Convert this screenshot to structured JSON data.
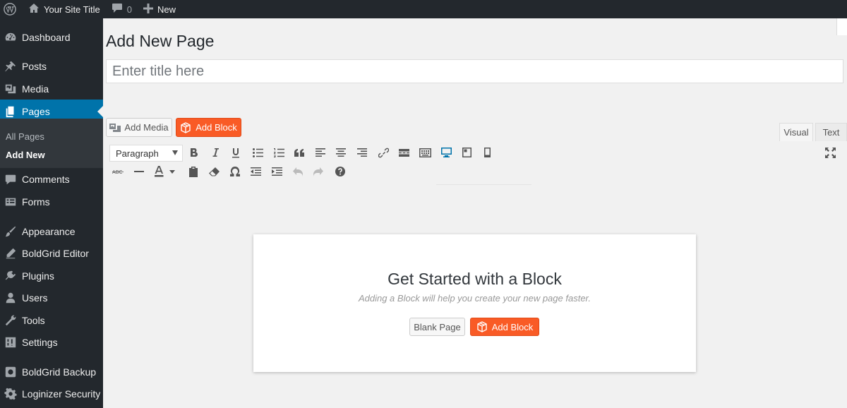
{
  "adminbar": {
    "site_title": "Your Site Title",
    "comments_count": "0",
    "new_label": "New"
  },
  "sidebar": {
    "items": [
      {
        "label": "Dashboard",
        "icon": "dashboard-icon"
      },
      {
        "label": "Posts",
        "icon": "pin-icon"
      },
      {
        "label": "Media",
        "icon": "media-icon"
      },
      {
        "label": "Pages",
        "icon": "page-icon",
        "active": true
      },
      {
        "label": "Comments",
        "icon": "comment-icon"
      },
      {
        "label": "Forms",
        "icon": "forms-icon"
      },
      {
        "label": "Appearance",
        "icon": "brush-icon"
      },
      {
        "label": "BoldGrid Editor",
        "icon": "pencil-icon"
      },
      {
        "label": "Plugins",
        "icon": "plugin-icon"
      },
      {
        "label": "Users",
        "icon": "user-icon"
      },
      {
        "label": "Tools",
        "icon": "wrench-icon"
      },
      {
        "label": "Settings",
        "icon": "settings-icon"
      },
      {
        "label": "BoldGrid Backup",
        "icon": "backup-icon"
      },
      {
        "label": "Loginizer Security",
        "icon": "gear-icon"
      }
    ],
    "submenu": [
      {
        "label": "All Pages"
      },
      {
        "label": "Add New",
        "current": true
      }
    ]
  },
  "main": {
    "page_title": "Add New Page",
    "title_placeholder": "Enter title here",
    "add_media_label": "Add Media",
    "add_block_label": "Add Block",
    "tabs": {
      "visual": "Visual",
      "text": "Text"
    },
    "format_select": "Paragraph"
  },
  "card": {
    "title": "Get Started with a Block",
    "subtitle": "Adding a Block will help you create your new page faster.",
    "blank_label": "Blank Page",
    "add_block_label": "Add Block"
  },
  "colors": {
    "admin_bg": "#23282d",
    "active_menu": "#0073aa",
    "accent_orange": "#f95b26"
  }
}
